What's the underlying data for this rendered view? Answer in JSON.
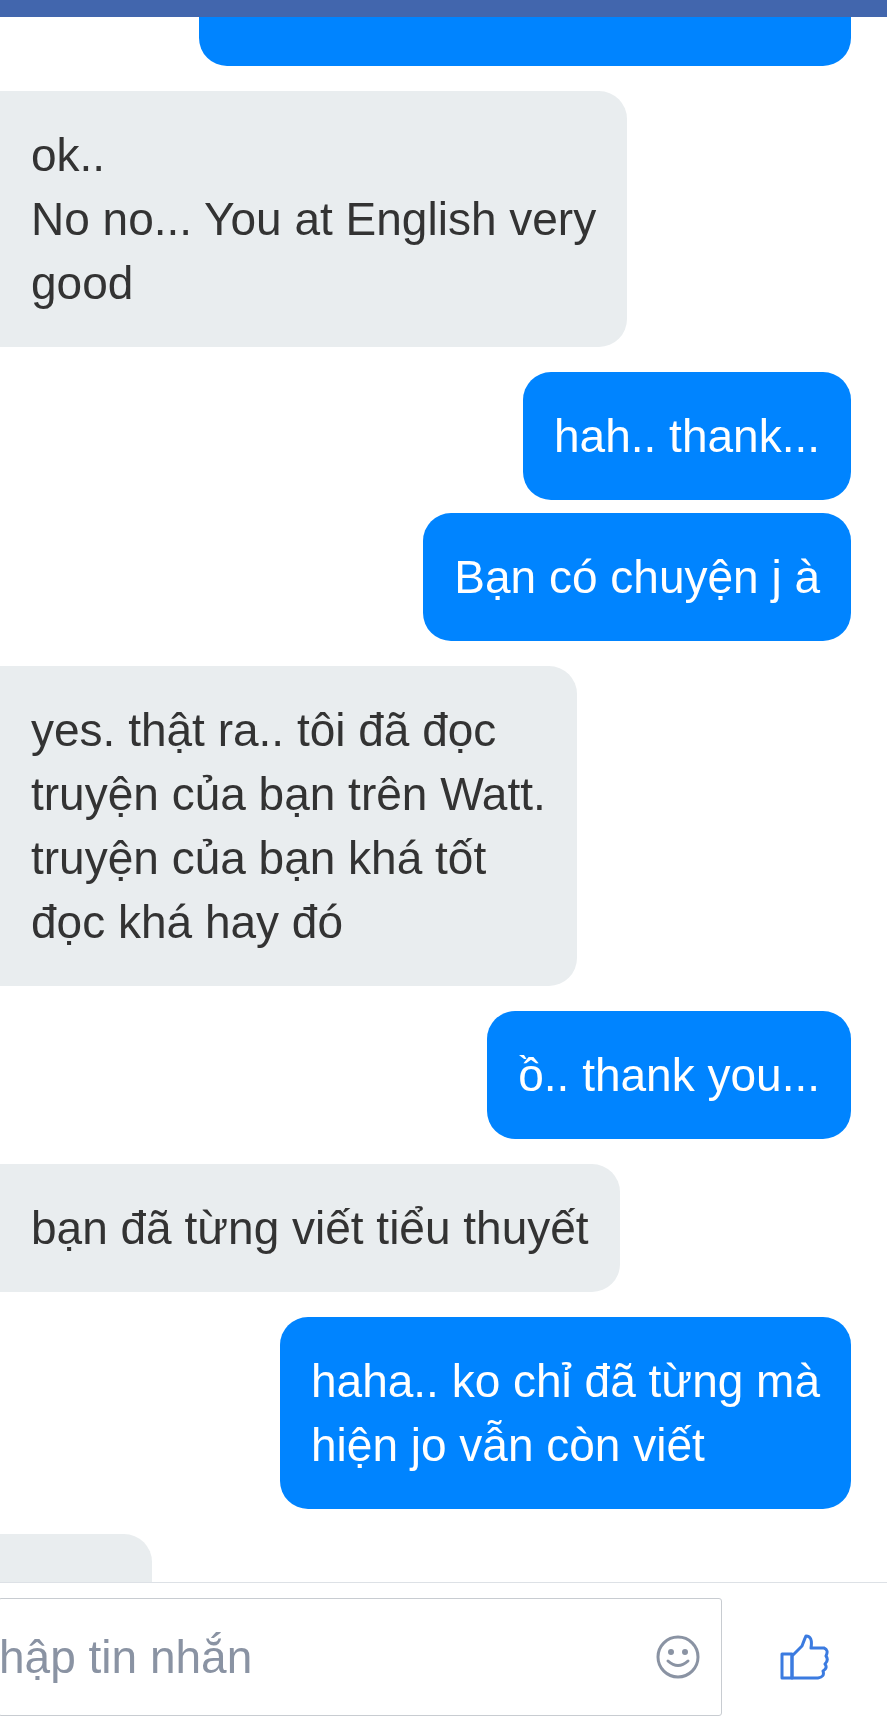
{
  "messages": [
    {
      "kind": "sent",
      "partial": true
    },
    {
      "kind": "received",
      "partial": false,
      "text": "ok..\nNo no... You at English very\ngood"
    },
    {
      "kind": "sent",
      "partial": false,
      "text": "hah.. thank..."
    },
    {
      "kind": "sent",
      "partial": false,
      "text": "Bạn có chuyện j à"
    },
    {
      "kind": "received",
      "partial": false,
      "text": "yes. thật ra.. tôi đã đọc\ntruyện của bạn trên Watt.\ntruyện của bạn khá tốt\nđọc khá hay đó"
    },
    {
      "kind": "sent",
      "partial": false,
      "text": "ồ.. thank you..."
    },
    {
      "kind": "received",
      "partial": false,
      "text": "bạn đã từng viết tiểu thuyết"
    },
    {
      "kind": "sent",
      "partial": false,
      "text": "haha.. ko chỉ đã từng mà\nhiện jo vẫn còn viết"
    },
    {
      "kind": "received",
      "partial": true
    }
  ],
  "composer": {
    "placeholder": "hập tin nhắn"
  }
}
